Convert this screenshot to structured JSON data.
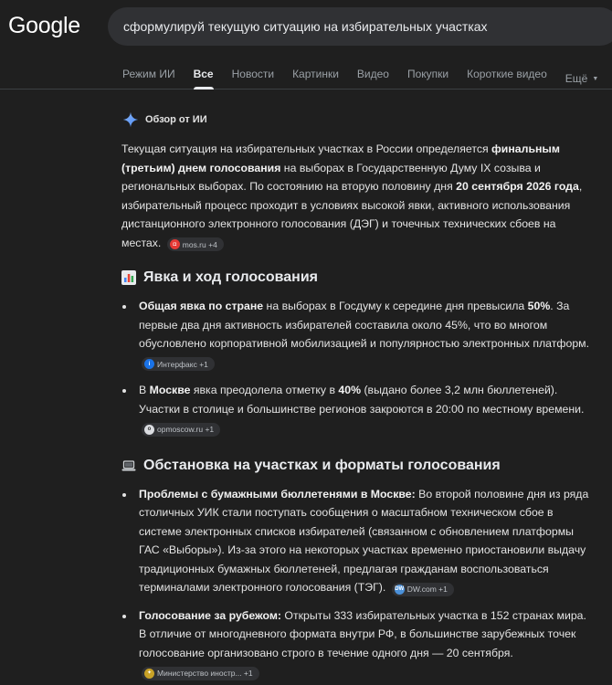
{
  "header": {
    "logo": "Google",
    "search_value": "сформулируй текущую ситуацию на избирательных участках"
  },
  "tabs": [
    "Режим ИИ",
    "Все",
    "Новости",
    "Картинки",
    "Видео",
    "Покупки",
    "Короткие видео",
    "Ещё"
  ],
  "tabs_active": "Все",
  "overview": {
    "title": "Обзор от ИИ",
    "intro": {
      "t1": "Текущая ситуация на избирательных участках в России определяется ",
      "b1": "финальным (третьим) днем голосования",
      "t2": " на выборах в Государственную Думу IX созыва и региональных выборах. По состоянию на вторую половину дня ",
      "b2": "20 сентября 2026 года",
      "t3": ", избирательный процесс проходит в условиях высокой явки, активного использования дистанционного электронного голосования (ДЭГ) и точечных технических сбоев на местах.",
      "chip": "mos.ru +4"
    }
  },
  "section1": {
    "title": "Явка и ход голосования",
    "items": [
      {
        "b1": "Общая явка по стране",
        "t1": " на выборах в Госдуму к середине дня превысила ",
        "b2": "50%",
        "t2": ". За первые два дня активность избирателей составила около 45%, что во многом обусловлено корпоративной мобилизацией и популярностью электронных платформ.",
        "chip": "Интерфакс +1"
      },
      {
        "t0": "В ",
        "b1": "Москве",
        "t1": " явка преодолела отметку в ",
        "b2": "40%",
        "t2": " (выдано более 3,2 млн бюллетеней). Участки в столице и большинстве регионов закроются в 20:00 по местному времени.",
        "chip": "opmoscow.ru +1"
      }
    ]
  },
  "section2": {
    "title": "Обстановка на участках и форматы голосования",
    "items": [
      {
        "b1": "Проблемы с бумажными бюллетенями в Москве:",
        "t1": " Во второй половине дня из ряда столичных УИК стали поступать сообщения о масштабном техническом сбое в системе электронных списков избирателей (связанном с обновлением платформы ГАС «Выборы»). Из-за этого на некоторых участках временно приостановили выдачу традиционных бумажных бюллетеней, предлагая гражданам воспользоваться терминалами электронного голосования (ТЭГ).",
        "chip": "DW.com +1"
      },
      {
        "b1": "Голосование за рубежом:",
        "t1": " Открыты 333 избирательных участка в 152 странах мира. В отличие от многодневного формата внутри РФ, в большинстве зарубежных точек голосование организовано строго в течение одного дня — 20 сентября.",
        "chip": "Министерство иностр... +1"
      }
    ]
  },
  "colors": {
    "background": "#1f1f1f",
    "search_bg": "#303134",
    "chip_bg": "#303134",
    "text": "#e3e3e3",
    "muted": "#9aa0a6"
  },
  "icons": [
    "gemini-sparkle-icon",
    "bar-chart-icon",
    "laptop-icon",
    "dropdown-caret-icon"
  ]
}
